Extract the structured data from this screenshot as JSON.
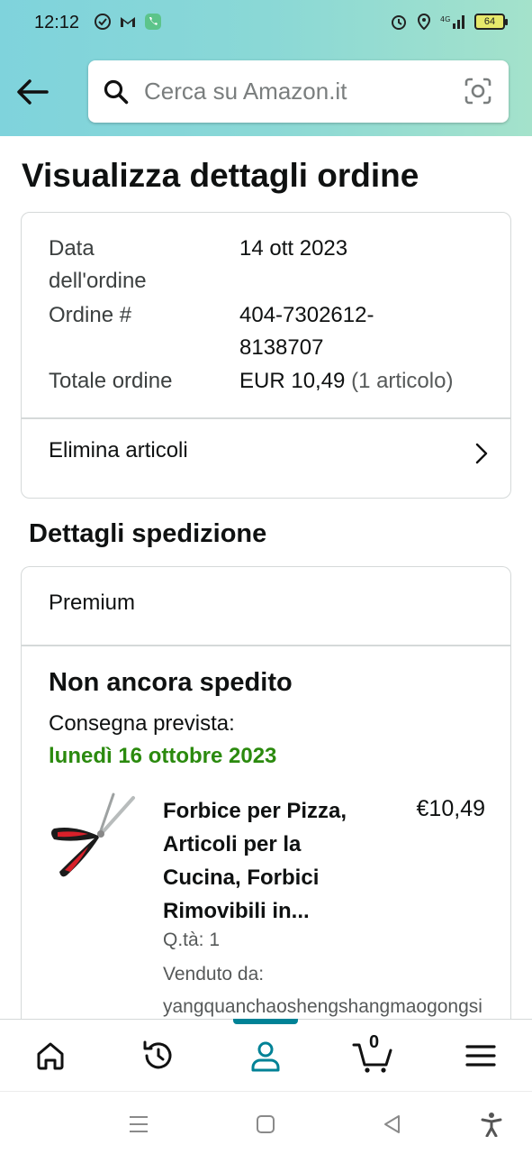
{
  "status_bar": {
    "time": "12:12",
    "battery": "64"
  },
  "search": {
    "placeholder": "Cerca su Amazon.it"
  },
  "page_title": "Visualizza dettagli ordine",
  "order_summary": {
    "rows": [
      {
        "label_line1": "Data",
        "label_line2": "dell'ordine",
        "value_line1": "14 ott 2023",
        "value_line2": ""
      },
      {
        "label_line1": "Ordine #",
        "label_line2": "",
        "value_line1": "404-7302612-",
        "value_line2": "8138707"
      },
      {
        "label_line1": "Totale ordine",
        "label_line2": "",
        "value_main": "EUR 10,49",
        "value_muted": "(1 articolo)"
      }
    ],
    "remove_items_label": "Elimina articoli"
  },
  "shipping": {
    "section_title": "Dettagli spedizione",
    "shipping_type": "Premium",
    "status": "Non ancora spedito",
    "delivery_label": "Consegna prevista:",
    "delivery_date": "lunedì 16 ottobre 2023",
    "product": {
      "title_lines": [
        "Forbice per Pizza,",
        "Articoli per la",
        "Cucina, Forbici",
        "Rimovibili in..."
      ],
      "price": "€10,49",
      "qty": "Q.tà: 1",
      "sold_by_label": "Venduto da:",
      "sold_by_value": "yangquanchaoshengshangmaogongsi"
    }
  },
  "bottom_nav": {
    "cart_count": "0",
    "active_tab": "account",
    "accent_color": "#008296"
  },
  "colors": {
    "delivery_green": "#2b8a0e",
    "header_gradient_start": "#7fd3dc",
    "header_gradient_end": "#a4e2cb"
  }
}
